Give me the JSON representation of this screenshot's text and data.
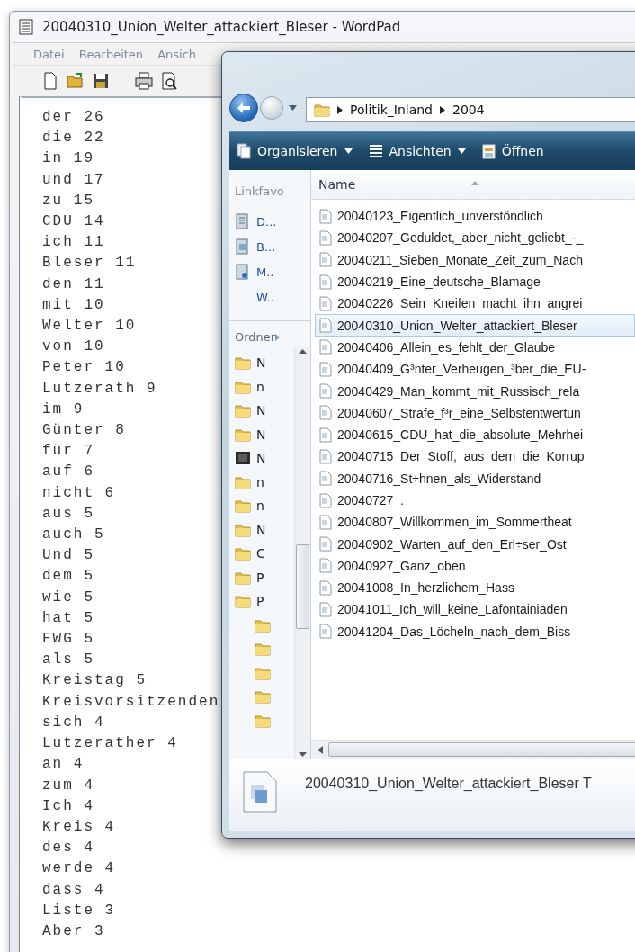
{
  "wordpad": {
    "title": "20040310_Union_Welter_attackiert_Bleser - WordPad",
    "menu": [
      "Datei",
      "Bearbeiten",
      "Ansich"
    ],
    "lines": [
      "der 26",
      "die 22",
      "in 19",
      "und 17",
      "zu 15",
      "CDU 14",
      "ich 11",
      "Bleser 11",
      "den 11",
      "mit 10",
      "Welter 10",
      "von 10",
      "Peter 10",
      "Lutzerath 9",
      "im 9",
      "Günter 8",
      "für 7",
      "auf 6",
      "nicht 6",
      "aus 5",
      "auch 5",
      "Und 5",
      "dem 5",
      "wie 5",
      "hat 5",
      "FWG 5",
      "als 5",
      "Kreistag 5",
      "Kreisvorsitzenden",
      "sich 4",
      "Lutzerather 4",
      "an 4",
      "zum 4",
      "Ich 4",
      "Kreis 4",
      "des 4",
      "werde 4",
      "dass 4",
      "Liste 3",
      "Aber 3"
    ]
  },
  "explorer": {
    "breadcrumb": [
      "Politik_Inland",
      "2004"
    ],
    "commands": [
      {
        "label": "Organisieren",
        "kind": "organize",
        "dropdown": true
      },
      {
        "label": "Ansichten",
        "kind": "views",
        "dropdown": true
      },
      {
        "label": "Öffnen",
        "kind": "open",
        "dropdown": false
      }
    ],
    "favorites_heading": "Linkfavo",
    "favorites": [
      {
        "label": "D...",
        "kind": "documents"
      },
      {
        "label": "B...",
        "kind": "pictures"
      },
      {
        "label": "M..",
        "kind": "music"
      },
      {
        "label": "W..",
        "kind": "plain"
      }
    ],
    "folders_heading": "Ordner",
    "folders": [
      {
        "label": "N",
        "kind": "folder"
      },
      {
        "label": "n",
        "kind": "folder"
      },
      {
        "label": "N",
        "kind": "folder"
      },
      {
        "label": "N",
        "kind": "folder"
      },
      {
        "label": "N",
        "kind": "video"
      },
      {
        "label": "n",
        "kind": "folder"
      },
      {
        "label": "n",
        "kind": "folder"
      },
      {
        "label": "N",
        "kind": "folder"
      },
      {
        "label": "C",
        "kind": "folder"
      },
      {
        "label": "P",
        "kind": "folder"
      },
      {
        "label": "P",
        "kind": "folder",
        "children": [
          {
            "kind": "folder"
          },
          {
            "kind": "folder"
          },
          {
            "kind": "folder"
          },
          {
            "kind": "folder"
          },
          {
            "kind": "folder"
          }
        ]
      }
    ],
    "column": "Name",
    "files": [
      {
        "name": "20040123_Eigentlich_unverstöndlich",
        "selected": false
      },
      {
        "name": "20040207_Geduldet,_aber_nicht_geliebt_-_",
        "selected": false
      },
      {
        "name": "20040211_Sieben_Monate_Zeit_zum_Nach",
        "selected": false
      },
      {
        "name": "20040219_Eine_deutsche_Blamage",
        "selected": false
      },
      {
        "name": "20040226_Sein_Kneifen_macht_ihn_angrei",
        "selected": false
      },
      {
        "name": "20040310_Union_Welter_attackiert_Bleser",
        "selected": true
      },
      {
        "name": "20040406_Allein_es_fehlt_der_Glaube",
        "selected": false
      },
      {
        "name": "20040409_G³nter_Verheugen_³ber_die_EU-",
        "selected": false
      },
      {
        "name": "20040429_Man_kommt_mit_Russisch_rela",
        "selected": false
      },
      {
        "name": "20040607_Strafe_f³r_eine_Selbstentwertun",
        "selected": false
      },
      {
        "name": "20040615_CDU_hat_die_absolute_Mehrhei",
        "selected": false
      },
      {
        "name": "20040715_Der_Stoff,_aus_dem_die_Korrup",
        "selected": false
      },
      {
        "name": "20040716_St÷hnen_als_Widerstand",
        "selected": false
      },
      {
        "name": "20040727_.",
        "selected": false
      },
      {
        "name": "20040807_Willkommen_im_Sommertheat",
        "selected": false
      },
      {
        "name": "20040902_Warten_auf_den_Erl÷ser_Ost",
        "selected": false
      },
      {
        "name": "20040927_Ganz_oben",
        "selected": false
      },
      {
        "name": "20041008_In_herzlichem_Hass",
        "selected": false
      },
      {
        "name": "20041011_Ich_will_keine_Lafontainiaden",
        "selected": false
      },
      {
        "name": "20041204_Das_Löcheln_nach_dem_Biss",
        "selected": false
      }
    ],
    "details": {
      "name": "20040310_Union_Welter_attackiert_Bleser T"
    }
  }
}
